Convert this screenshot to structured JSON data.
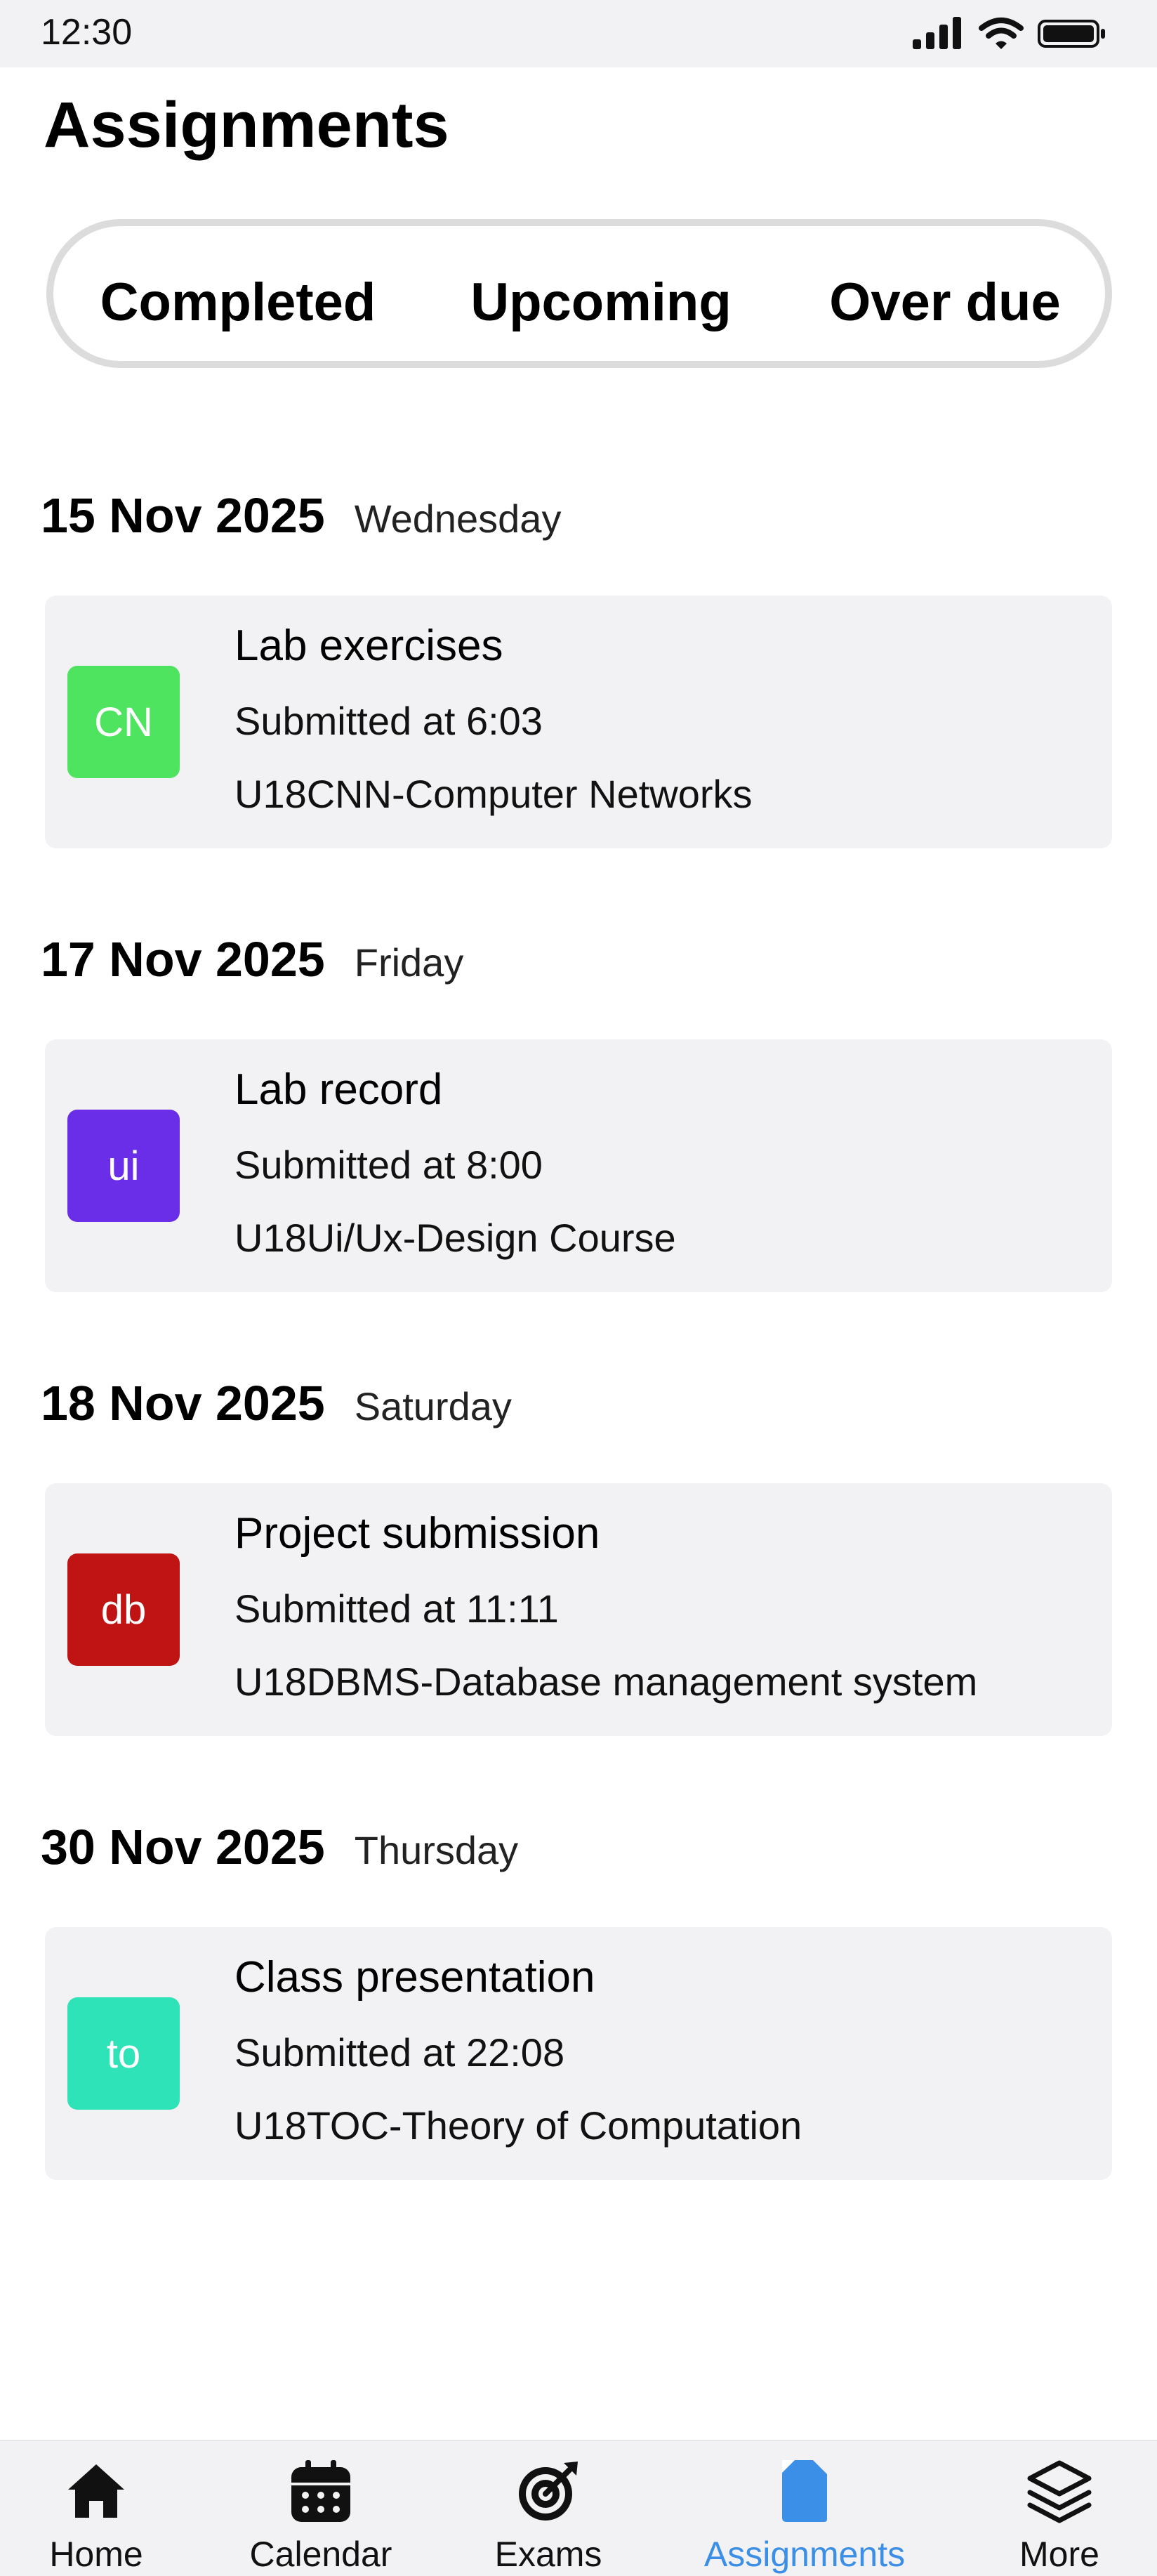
{
  "status_bar": {
    "time": "12:30"
  },
  "page": {
    "title": "Assignments"
  },
  "tabs": [
    {
      "label": "Completed",
      "active": true
    },
    {
      "label": "Upcoming",
      "active": false
    },
    {
      "label": "Over due",
      "active": false
    }
  ],
  "groups": [
    {
      "date": "15 Nov 2025",
      "day": "Wednesday",
      "item": {
        "badge": "CN",
        "badge_color": "#4ee45f",
        "title": "Lab exercises",
        "submitted": "Submitted at 6:03",
        "course": "U18CNN-Computer Networks"
      }
    },
    {
      "date": "17 Nov 2025",
      "day": "Friday",
      "item": {
        "badge": "ui",
        "badge_color": "#6a2ee8",
        "title": "Lab record",
        "submitted": "Submitted at 8:00",
        "course": "U18Ui/Ux-Design Course"
      }
    },
    {
      "date": "18 Nov 2025",
      "day": "Saturday",
      "item": {
        "badge": "db",
        "badge_color": "#c01414",
        "title": "Project submission",
        "submitted": "Submitted at 11:11",
        "course": "U18DBMS-Database management system"
      }
    },
    {
      "date": "30 Nov 2025",
      "day": "Thursday",
      "item": {
        "badge": "to",
        "badge_color": "#2ee3b7",
        "title": "Class presentation",
        "submitted": "Submitted at 22:08",
        "course": "U18TOC-Theory of Computation"
      }
    }
  ],
  "bottom_nav": [
    {
      "label": "Home",
      "icon": "home-icon",
      "active": false
    },
    {
      "label": "Calendar",
      "icon": "calendar-icon",
      "active": false
    },
    {
      "label": "Exams",
      "icon": "target-icon",
      "active": false
    },
    {
      "label": "Assignments",
      "icon": "document-icon",
      "active": true
    },
    {
      "label": "More",
      "icon": "layers-icon",
      "active": false
    }
  ],
  "colors": {
    "accent": "#3b8fe6",
    "card_bg": "#f2f2f4"
  }
}
